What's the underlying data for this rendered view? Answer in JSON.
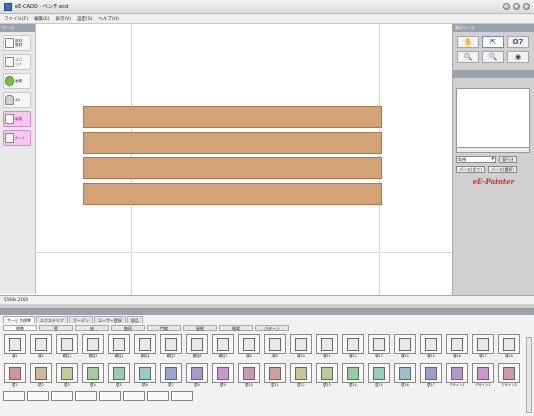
{
  "window": {
    "title": "eE-CADO - ベンチ.ecd"
  },
  "menu": [
    "ファイル(F)",
    "編集(E)",
    "表示(V)",
    "設定(S)",
    "ヘルプ(H)"
  ],
  "left_toolbox": {
    "title": "ツール",
    "buttons": [
      {
        "label": "部材\n登録",
        "style": "normal"
      },
      {
        "label": "ユニ\nット",
        "style": "normal"
      },
      {
        "label": "画像",
        "style": "normal"
      },
      {
        "label": "3D",
        "style": "normal"
      },
      {
        "label": "編集",
        "style": "pink"
      },
      {
        "label": "カット",
        "style": "pink"
      }
    ]
  },
  "right_panel": {
    "title": "表示ツール",
    "tool_icons": [
      "hand-icon",
      "pointer-icon",
      "rotate-icon",
      "zoom-in-icon",
      "zoom-out-icon",
      "eye-icon"
    ],
    "preview_title": "プレビュー",
    "select_value": "斜視",
    "select_button": "奥行き",
    "buttons": [
      "パース(全て)",
      "パース(選択)"
    ],
    "logo": "eE-Painter"
  },
  "canvas": {
    "planks": 4,
    "plank_color": "#d4a277"
  },
  "status": {
    "text": "5504x 2160"
  },
  "library": {
    "tabs": [
      "サービス標準",
      "エクステリア",
      "ガーデン",
      "ユーザー登録",
      "部品"
    ],
    "active_tab": 0,
    "subtabs": [
      "標準",
      "壁",
      "床",
      "階段",
      "門扉",
      "屋根",
      "植栽",
      "パターン"
    ],
    "active_subtab": 0,
    "row1": [
      "塀1",
      "塀2",
      "塀柱1",
      "塀柱2",
      "塀柱3",
      "塀柱4",
      "塀柱5",
      "塀柱6",
      "塀柱7",
      "塀8",
      "塀9",
      "塀10",
      "塀11",
      "塀12",
      "塀13",
      "塀14",
      "塀15",
      "塀16",
      "塀17",
      "塀18"
    ],
    "row2": [
      "壁1",
      "壁2",
      "壁3",
      "壁4",
      "壁5",
      "壁6",
      "壁7",
      "壁8",
      "壁9",
      "壁10",
      "壁11",
      "壁12",
      "壁13",
      "壁14",
      "壁15",
      "壁16",
      "壁17",
      "デザイン1",
      "デザイン2",
      "デザイン3"
    ],
    "row3_count": 8
  }
}
